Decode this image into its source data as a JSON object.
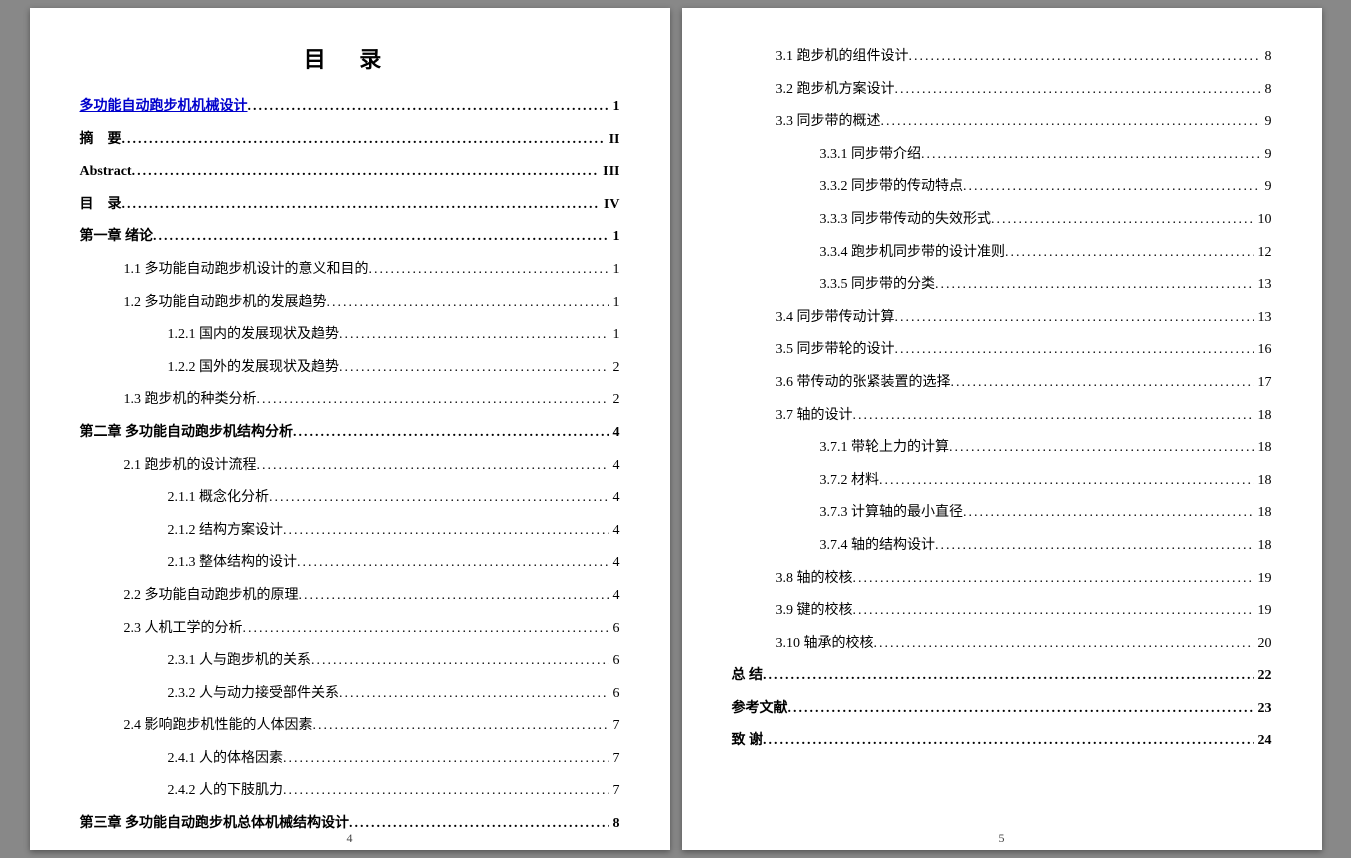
{
  "title": "目 录",
  "left_page_num": "4",
  "right_page_num": "5",
  "left_entries": [
    {
      "level": 0,
      "label": "多功能自动跑步机机械设计",
      "page": "1",
      "link": true
    },
    {
      "level": 0,
      "label": "摘　要",
      "page": "II"
    },
    {
      "level": 0,
      "label": "Abstract",
      "page": "III"
    },
    {
      "level": 0,
      "label": "目　录",
      "page": "IV"
    },
    {
      "level": 0,
      "label": "第一章 绪论",
      "page": "1"
    },
    {
      "level": 1,
      "label": "1.1 多功能自动跑步机设计的意义和目的",
      "page": "1"
    },
    {
      "level": 1,
      "label": "1.2 多功能自动跑步机的发展趋势",
      "page": "1"
    },
    {
      "level": 2,
      "label": "1.2.1 国内的发展现状及趋势",
      "page": "1"
    },
    {
      "level": 2,
      "label": "1.2.2 国外的发展现状及趋势",
      "page": "2"
    },
    {
      "level": 1,
      "label": "1.3 跑步机的种类分析",
      "page": "2"
    },
    {
      "level": 0,
      "label": "第二章 多功能自动跑步机结构分析",
      "page": "4"
    },
    {
      "level": 1,
      "label": "2.1 跑步机的设计流程",
      "page": "4"
    },
    {
      "level": 2,
      "label": "2.1.1 概念化分析",
      "page": "4"
    },
    {
      "level": 2,
      "label": "2.1.2 结构方案设计",
      "page": "4"
    },
    {
      "level": 2,
      "label": "2.1.3 整体结构的设计",
      "page": "4"
    },
    {
      "level": 1,
      "label": "2.2 多功能自动跑步机的原理",
      "page": "4"
    },
    {
      "level": 1,
      "label": "2.3 人机工学的分析",
      "page": "6"
    },
    {
      "level": 2,
      "label": "2.3.1 人与跑步机的关系",
      "page": "6"
    },
    {
      "level": 2,
      "label": "2.3.2 人与动力接受部件关系",
      "page": "6"
    },
    {
      "level": 1,
      "label": "2.4 影响跑步机性能的人体因素",
      "page": "7"
    },
    {
      "level": 2,
      "label": "2.4.1 人的体格因素",
      "page": "7"
    },
    {
      "level": 2,
      "label": "2.4.2 人的下肢肌力",
      "page": "7"
    },
    {
      "level": 0,
      "label": "第三章 多功能自动跑步机总体机械结构设计",
      "page": "8"
    }
  ],
  "right_entries": [
    {
      "level": 1,
      "label": "3.1 跑步机的组件设计",
      "page": "8"
    },
    {
      "level": 1,
      "label": "3.2 跑步机方案设计",
      "page": "8"
    },
    {
      "level": 1,
      "label": "3.3 同步带的概述",
      "page": "9"
    },
    {
      "level": 2,
      "label": "3.3.1 同步带介绍",
      "page": "9"
    },
    {
      "level": 2,
      "label": "3.3.2 同步带的传动特点",
      "page": "9"
    },
    {
      "level": 2,
      "label": "3.3.3 同步带传动的失效形式",
      "page": "10"
    },
    {
      "level": 2,
      "label": "3.3.4 跑步机同步带的设计准则",
      "page": "12"
    },
    {
      "level": 2,
      "label": "3.3.5 同步带的分类",
      "page": "13"
    },
    {
      "level": 1,
      "label": "3.4 同步带传动计算",
      "page": "13"
    },
    {
      "level": 1,
      "label": "3.5 同步带轮的设计",
      "page": "16"
    },
    {
      "level": 1,
      "label": "3.6 带传动的张紧装置的选择",
      "page": "17"
    },
    {
      "level": 1,
      "label": "3.7 轴的设计",
      "page": "18"
    },
    {
      "level": 2,
      "label": "3.7.1 带轮上力的计算",
      "page": "18"
    },
    {
      "level": 2,
      "label": "3.7.2 材料",
      "page": "18"
    },
    {
      "level": 2,
      "label": "3.7.3 计算轴的最小直径",
      "page": "18"
    },
    {
      "level": 2,
      "label": "3.7.4 轴的结构设计",
      "page": "18"
    },
    {
      "level": 1,
      "label": "3.8 轴的校核",
      "page": "19"
    },
    {
      "level": 1,
      "label": "3.9 键的校核",
      "page": "19"
    },
    {
      "level": 1,
      "label": "3.10 轴承的校核",
      "page": "20"
    },
    {
      "level": 0,
      "label": "总 结",
      "page": "22"
    },
    {
      "level": 0,
      "label": "参考文献",
      "page": "23"
    },
    {
      "level": 0,
      "label": "致 谢",
      "page": "24"
    }
  ]
}
